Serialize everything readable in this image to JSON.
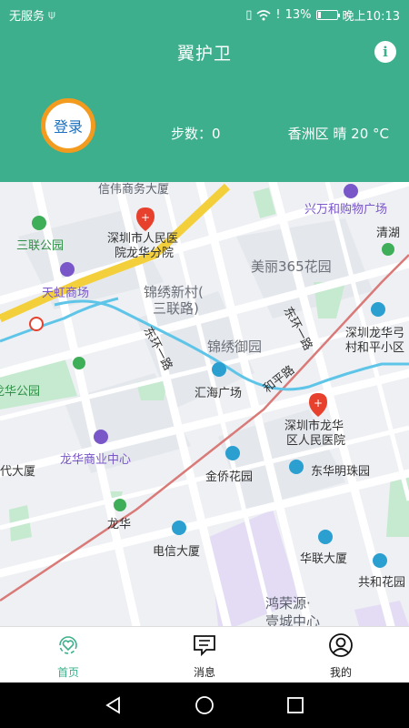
{
  "status_bar": {
    "carrier": "无服务",
    "battery": "13%",
    "battery_level": 0.13,
    "time": "晚上10:13"
  },
  "header": {
    "title": "翼护卫",
    "login_label": "登录",
    "steps": "步数：0",
    "weather": "香洲区 晴 20 °C"
  },
  "map": {
    "labels": {
      "l01": "信伟商务大厦",
      "l02": "深圳市人民医",
      "l03": "院龙华分院",
      "l04": "兴万和购物广场",
      "l05": "清湖",
      "l06": "三联公园",
      "l07": "美丽365花园",
      "l08": "天虹商场",
      "l09": "锦绣新村(",
      "l10": "三联路)",
      "l11": "深圳龙华弓",
      "l12": "村和平小区",
      "l13": "锦绣御园",
      "l14": "东环一路",
      "l15": "东环一路",
      "l16": "和平路",
      "l17": "汇海广场",
      "l18": "龙华公园",
      "l19": "深圳市龙华",
      "l20": "区人民医院",
      "l21": "龙华商业中心",
      "l22": "代大厦",
      "l23": "金侨花园",
      "l24": "东华明珠园",
      "l25": "龙华",
      "l26": "电信大厦",
      "l27": "华联大厦",
      "l28": "共和花园",
      "l29": "鸿荣源·",
      "l30": "壹城中心"
    }
  },
  "tabs": [
    {
      "label": "首页",
      "icon": "home-heart-icon",
      "active": true
    },
    {
      "label": "消息",
      "icon": "message-icon",
      "active": false
    },
    {
      "label": "我的",
      "icon": "profile-icon",
      "active": false
    }
  ],
  "colors": {
    "brand": "#3daf8c",
    "login_ring": "#f29b1f",
    "login_text": "#1a6fbf"
  }
}
